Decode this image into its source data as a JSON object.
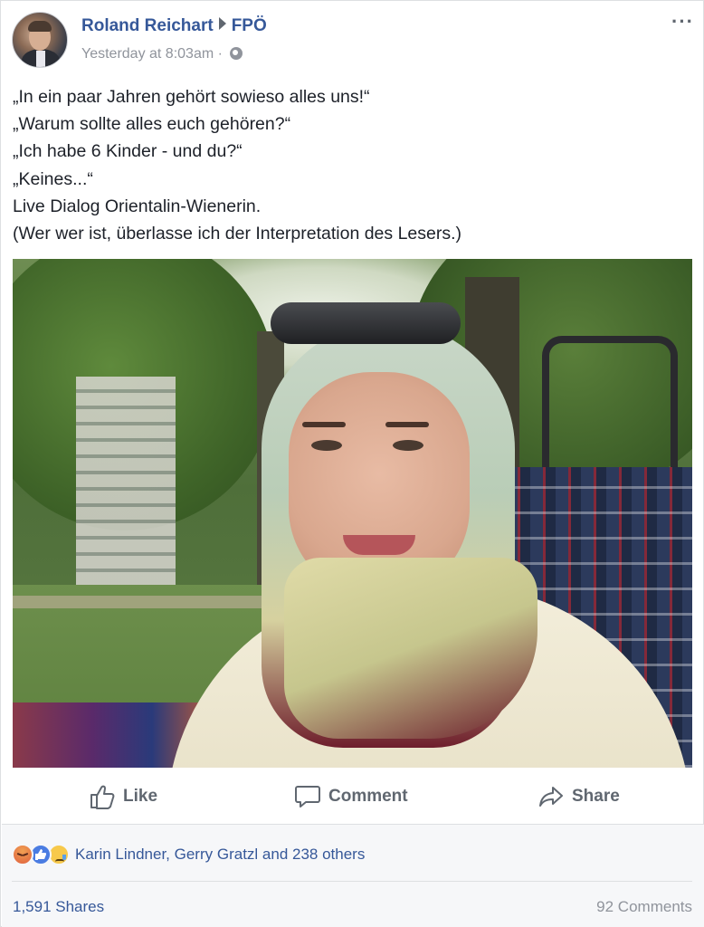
{
  "post": {
    "author": "Roland Reichart",
    "target": "FPÖ",
    "timestamp": "Yesterday at 8:03am",
    "separator": "·",
    "more_label": "···",
    "text_lines": [
      "„In ein paar Jahren gehört sowieso alles uns!“",
      "„Warum sollte alles euch gehören?“",
      "„Ich habe 6 Kinder - und du?“",
      "„Keines...“",
      "Live Dialog Orientalin-Wienerin.",
      "(Wer wer ist, überlasse ich der Interpretation des Lesers.)"
    ]
  },
  "actions": {
    "like_label": "Like",
    "comment_label": "Comment",
    "share_label": "Share"
  },
  "footer": {
    "reactions": [
      "angry",
      "like",
      "sad"
    ],
    "reaction_names": "Karin Lindner, Gerry Gratzl and 238 others",
    "shares": "1,591 Shares",
    "comments": "92 Comments"
  },
  "colors": {
    "link": "#365899",
    "muted": "#90949c",
    "action": "#606770",
    "footer_bg": "#f6f7f9"
  },
  "icons": {
    "like": "thumbs-up-icon",
    "comment": "speech-bubble-icon",
    "share": "share-arrow-icon",
    "privacy": "globe-icon",
    "more": "ellipsis-icon"
  }
}
